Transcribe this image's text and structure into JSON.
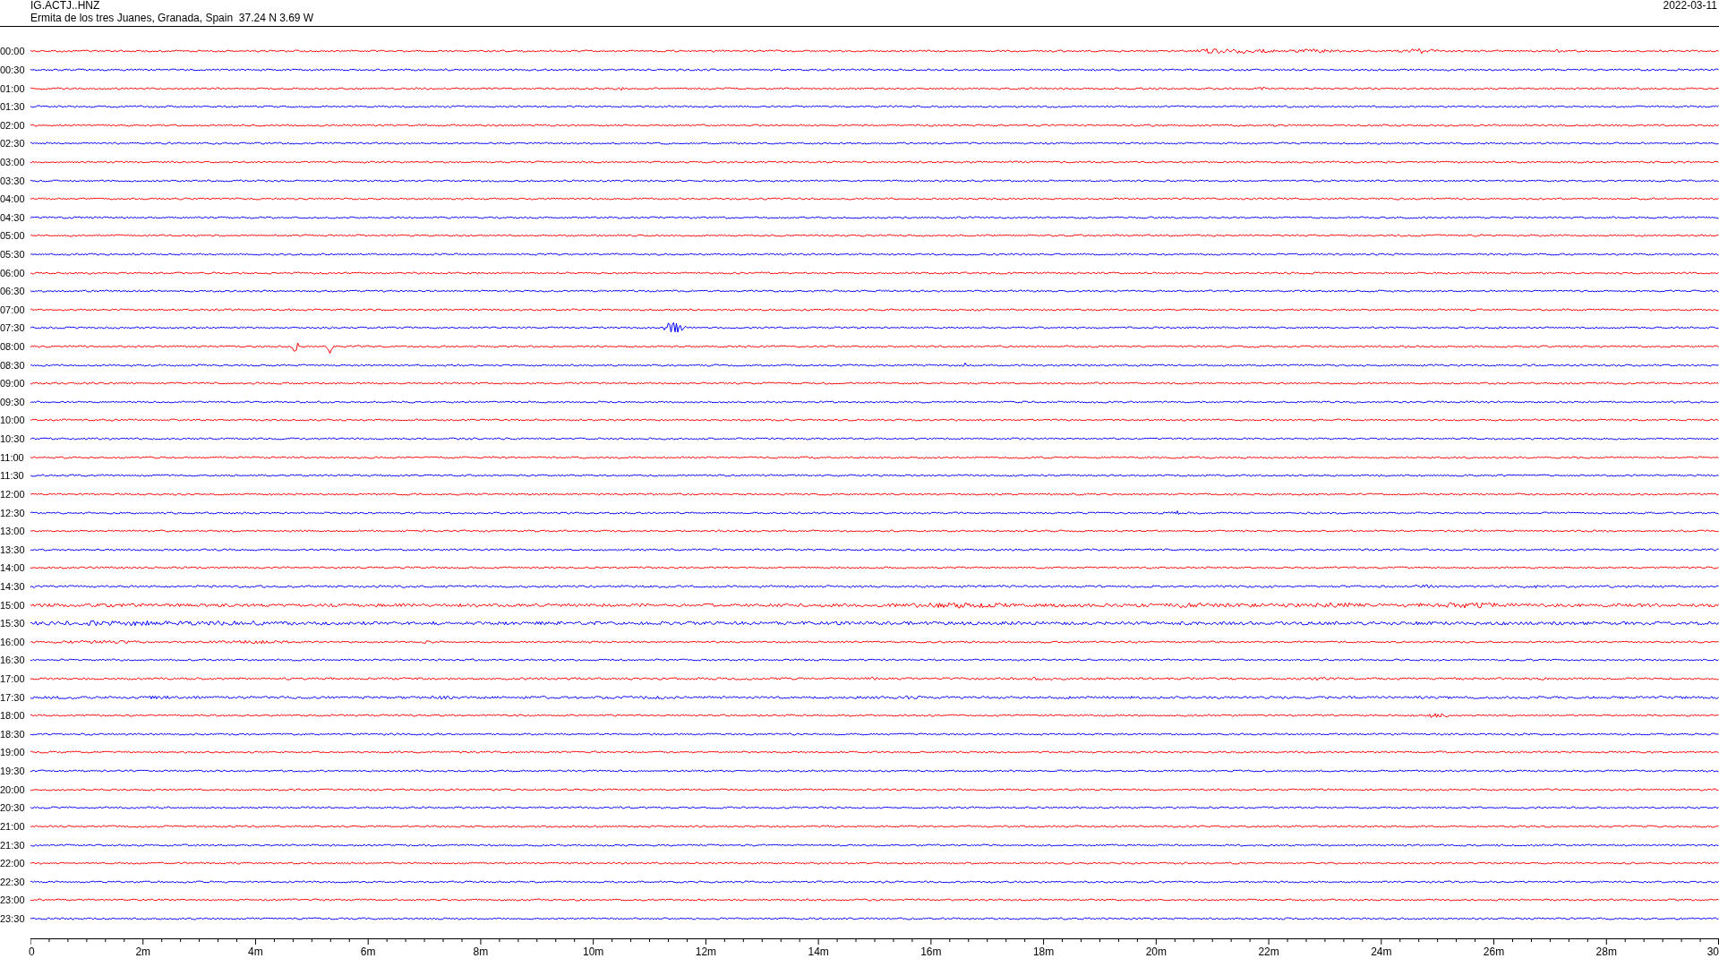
{
  "header": {
    "station": "IG.ACTJ..HNZ",
    "location": "Ermita de los tres Juanes, Granada, Spain  37.24 N 3.69 W",
    "date": "2022-03-11"
  },
  "rows": [
    {
      "label": "00:00",
      "color": "#ff0000"
    },
    {
      "label": "00:30",
      "color": "#0000ff"
    },
    {
      "label": "01:00",
      "color": "#ff0000"
    },
    {
      "label": "01:30",
      "color": "#0000ff"
    },
    {
      "label": "02:00",
      "color": "#ff0000"
    },
    {
      "label": "02:30",
      "color": "#0000ff"
    },
    {
      "label": "03:00",
      "color": "#ff0000"
    },
    {
      "label": "03:30",
      "color": "#0000ff"
    },
    {
      "label": "04:00",
      "color": "#ff0000"
    },
    {
      "label": "04:30",
      "color": "#0000ff"
    },
    {
      "label": "05:00",
      "color": "#ff0000"
    },
    {
      "label": "05:30",
      "color": "#0000ff"
    },
    {
      "label": "06:00",
      "color": "#ff0000"
    },
    {
      "label": "06:30",
      "color": "#0000ff"
    },
    {
      "label": "07:00",
      "color": "#ff0000"
    },
    {
      "label": "07:30",
      "color": "#0000ff"
    },
    {
      "label": "08:00",
      "color": "#ff0000"
    },
    {
      "label": "08:30",
      "color": "#0000ff"
    },
    {
      "label": "09:00",
      "color": "#ff0000"
    },
    {
      "label": "09:30",
      "color": "#0000ff"
    },
    {
      "label": "10:00",
      "color": "#ff0000"
    },
    {
      "label": "10:30",
      "color": "#0000ff"
    },
    {
      "label": "11:00",
      "color": "#ff0000"
    },
    {
      "label": "11:30",
      "color": "#0000ff"
    },
    {
      "label": "12:00",
      "color": "#ff0000"
    },
    {
      "label": "12:30",
      "color": "#0000ff"
    },
    {
      "label": "13:00",
      "color": "#ff0000"
    },
    {
      "label": "13:30",
      "color": "#0000ff"
    },
    {
      "label": "14:00",
      "color": "#ff0000"
    },
    {
      "label": "14:30",
      "color": "#0000ff"
    },
    {
      "label": "15:00",
      "color": "#ff0000"
    },
    {
      "label": "15:30",
      "color": "#0000ff"
    },
    {
      "label": "16:00",
      "color": "#ff0000"
    },
    {
      "label": "16:30",
      "color": "#0000ff"
    },
    {
      "label": "17:00",
      "color": "#ff0000"
    },
    {
      "label": "17:30",
      "color": "#0000ff"
    },
    {
      "label": "18:00",
      "color": "#ff0000"
    },
    {
      "label": "18:30",
      "color": "#0000ff"
    },
    {
      "label": "19:00",
      "color": "#ff0000"
    },
    {
      "label": "19:30",
      "color": "#0000ff"
    },
    {
      "label": "20:00",
      "color": "#ff0000"
    },
    {
      "label": "20:30",
      "color": "#0000ff"
    },
    {
      "label": "21:00",
      "color": "#ff0000"
    },
    {
      "label": "21:30",
      "color": "#0000ff"
    },
    {
      "label": "22:00",
      "color": "#ff0000"
    },
    {
      "label": "22:30",
      "color": "#0000ff"
    },
    {
      "label": "23:00",
      "color": "#ff0000"
    },
    {
      "label": "23:30",
      "color": "#0000ff"
    }
  ],
  "x_axis": {
    "labels": [
      "0",
      "2m",
      "4m",
      "6m",
      "8m",
      "10m",
      "12m",
      "14m",
      "16m",
      "18m",
      "20m",
      "22m",
      "24m",
      "26m",
      "28m",
      "30"
    ]
  }
}
